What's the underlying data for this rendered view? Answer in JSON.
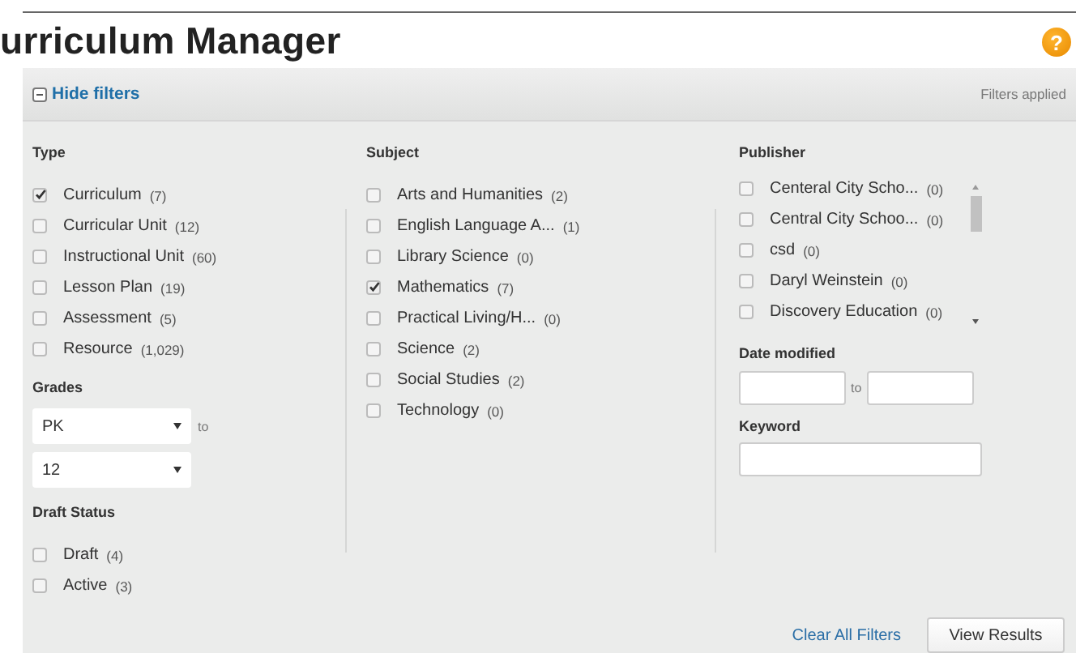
{
  "title": "urriculum Manager",
  "help": "?",
  "filters_bar": {
    "toggle": "Hide filters",
    "expanded": true,
    "status": "Filters applied"
  },
  "type": {
    "heading": "Type",
    "options": [
      {
        "label": "Curriculum",
        "count": "(7)",
        "checked": true
      },
      {
        "label": "Curricular Unit",
        "count": "(12)",
        "checked": false
      },
      {
        "label": "Instructional Unit",
        "count": "(60)",
        "checked": false
      },
      {
        "label": "Lesson Plan",
        "count": "(19)",
        "checked": false
      },
      {
        "label": "Assessment",
        "count": "(5)",
        "checked": false
      },
      {
        "label": "Resource",
        "count": "(1,029)",
        "checked": false
      }
    ]
  },
  "grades": {
    "heading": "Grades",
    "from": "PK",
    "separator": "to",
    "to": "12"
  },
  "draft_status": {
    "heading": "Draft Status",
    "options": [
      {
        "label": "Draft",
        "count": "(4)",
        "checked": false
      },
      {
        "label": "Active",
        "count": "(3)",
        "checked": false
      }
    ]
  },
  "subject": {
    "heading": "Subject",
    "options": [
      {
        "label": "Arts and Humanities",
        "count": "(2)",
        "checked": false
      },
      {
        "label": "English Language A...",
        "count": "(1)",
        "checked": false
      },
      {
        "label": "Library Science",
        "count": "(0)",
        "checked": false
      },
      {
        "label": "Mathematics",
        "count": "(7)",
        "checked": true
      },
      {
        "label": "Practical Living/H...",
        "count": "(0)",
        "checked": false
      },
      {
        "label": "Science",
        "count": "(2)",
        "checked": false
      },
      {
        "label": "Social Studies",
        "count": "(2)",
        "checked": false
      },
      {
        "label": "Technology",
        "count": "(0)",
        "checked": false
      }
    ]
  },
  "publisher": {
    "heading": "Publisher",
    "options": [
      {
        "label": "Centeral City Scho...",
        "count": "(0)",
        "checked": false
      },
      {
        "label": "Central City Schoo...",
        "count": "(0)",
        "checked": false
      },
      {
        "label": "csd",
        "count": "(0)",
        "checked": false
      },
      {
        "label": "Daryl Weinstein",
        "count": "(0)",
        "checked": false
      },
      {
        "label": "Discovery Education",
        "count": "(0)",
        "checked": false
      }
    ]
  },
  "date_modified": {
    "heading": "Date modified",
    "separator": "to"
  },
  "keyword": {
    "heading": "Keyword"
  },
  "actions": {
    "clear": "Clear All Filters",
    "submit": "View Results"
  }
}
